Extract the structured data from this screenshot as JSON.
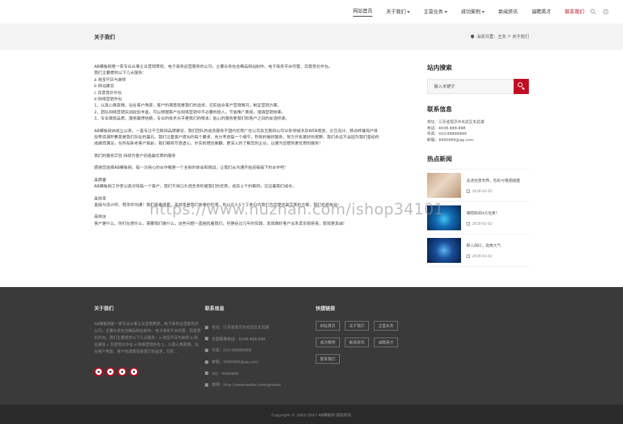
{
  "nav": {
    "items": [
      {
        "label": "网站首页",
        "dropdown": false
      },
      {
        "label": "关于我们",
        "dropdown": true
      },
      {
        "label": "主营业务",
        "dropdown": true
      },
      {
        "label": "成功案例",
        "dropdown": true
      },
      {
        "label": "新闻资讯",
        "dropdown": false
      },
      {
        "label": "诚聘英才",
        "dropdown": false
      },
      {
        "label": "联系我们",
        "dropdown": false
      }
    ],
    "accent_color": "#c00d23"
  },
  "titlebar": {
    "title": "关于我们",
    "breadcrumb_prefix": "当前位置：",
    "home": "主页",
    "separator": ">",
    "current": "关于我们"
  },
  "article": {
    "paragraphs": [
      "AB模板网是一家专业从事企业营销策划、电子商务运营服务的公司，主要业务包含精品网站制作、电子商务平台托管、百度竞价外包。",
      "我们主要提供以下几点服务：",
      "a  淘宝开店与装修",
      "b  网站建设",
      "c  百度竞价外包",
      "d  网络营销外包",
      "1、以真心换真情，站在客户角度，客户的满意就是我们的追求，切实结合客户营销情况，制定营销方案。",
      "2、团队网络营销实战经验丰富，可以根据客户在网络营销中不必要的投入，节省推广费用，增强营销效果。",
      "3、专业铸就品质，服务赢得信赖，专业的技术水平是我们的根本；贴心的服务是我们和客户之间的友谊桥梁。",
      "",
      "AB模板网自成立以来，一直专注于互联网品牌建设，我们团队的成员服务于国内优秀广告公司及互联网公司业务领域涉及WEB视觉、交互设计、移动终端用户体",
      "验等资源积累甚是我们存在的基石。我们注重客户提出的每个要求，充分考虑每一个细节，积极的做好服务，努力开拓更好的视野。我们永远不会因为我们曾经的",
      "成绩而满足，在所有新老客户面前，我们都将尽意虚心、扑实的理念推翻，更深入的了解您的企业，以便为您提供更优质的服务！",
      "",
      "我们的服务宗旨 持续为客户创造最优质的服务",
      "",
      "感谢您选择AB模板网，每一次用心的合作都是一个全新的体会和挑战，让我们从沟通开始迎接接下的合作吧！",
      "",
      "高质量",
      "AB模板网工作室以真对待每一个客户，我们不用口头语言来吹嘘我们的优秀，成百上千的案例，见证着我们成长。",
      "",
      "高效率",
      "直接与设计师、程序师沟通！我们面奏速度，高效率是我们信奉的狂魂，所以在3-5个工作日内我们为您提供最完美的方案，我们拒绝拖宕！",
      "",
      "高效信",
      "客户是什么，你们在想什么，需要我们做什么，这些问题一直困扰着我们。但是经过几年的实践，发现做好客户关系其实很容易，那就是真诚！"
    ]
  },
  "sidebar": {
    "search_title": "站内搜索",
    "search_placeholder": "输入关键字",
    "contact_title": "联系信息",
    "contact_lines": [
      "地址：江苏省南京市玄武区玄武湖",
      "电话：4008-888-888",
      "传真：010-88888888",
      "邮箱：9490489@qq.com"
    ],
    "news_title": "热点新闻",
    "news": [
      {
        "headline": "走进创意世界，色彩与情感碰撞",
        "date": "2018-02-02"
      },
      {
        "headline": "编程新闻4大包裹！",
        "date": "2018-02-02"
      },
      {
        "headline": "醉入网红，简美大气",
        "date": "2018-02-02"
      }
    ]
  },
  "watermark": "https://www.huzhan.com/ishop34101",
  "footer": {
    "about_title": "关于我们",
    "about_text": "AB模板网是一家专业从事企业营销策划、电子商务运营服务的公司，主要业务包含精品网站制作、电子商务平台托管、百度竞价外包。我们主要提供以下几点服务：a 淘宝开店与装修 b 网站建设 c 百度竞价外包 d 网络营销外包 1、以真心换真情，站在客户角度，客户的满意就是我们的追求，切实...",
    "contact_title": "联系信息",
    "contact_rows": [
      "地址：江苏省南京市玄武区玄武湖",
      "全国客服电话：4008-888-888",
      "传真：010-88888888",
      "邮箱：9490489@qq.com",
      "QQ：9490489",
      "微博：http://www.weibo.com/gooxao"
    ],
    "links_title": "快捷链接",
    "links": [
      "网站首页",
      "关于我们",
      "主营业务",
      "成功案例",
      "新闻资讯",
      "诚聘英才",
      "联系我们"
    ],
    "copyright": "Copyright © 2002-2017 AB模板网 版权所有"
  }
}
